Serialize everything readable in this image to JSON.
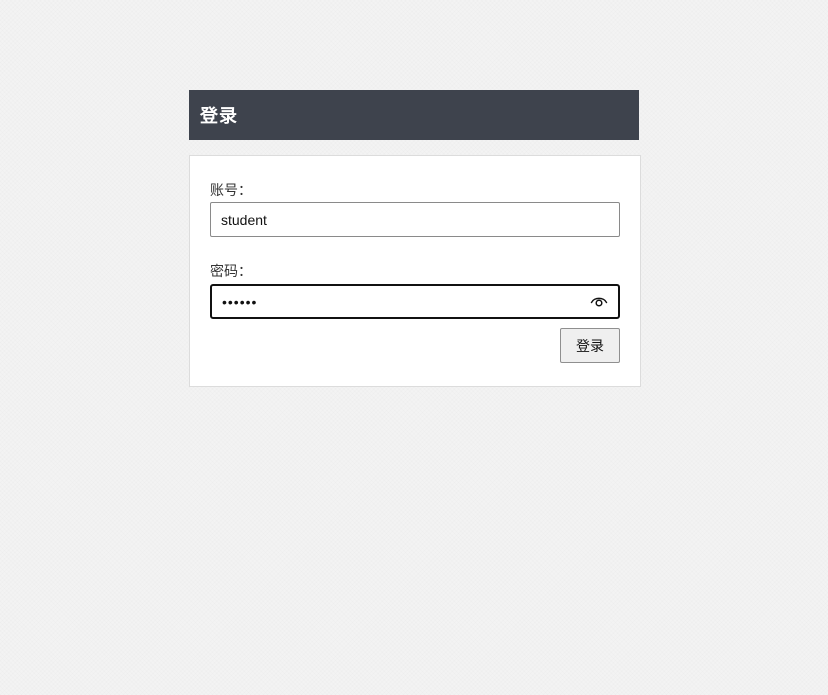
{
  "header": {
    "title": "登录"
  },
  "form": {
    "account_label": "账号：",
    "account_value": "student",
    "password_label": "密码：",
    "password_value": "••••••",
    "password_toggle_icon": "eye-icon",
    "submit_label": "登录"
  },
  "colors": {
    "header_bg": "#3e434d",
    "header_text": "#ffffff",
    "page_bg": "#f3f3f3",
    "panel_bg": "#ffffff"
  }
}
